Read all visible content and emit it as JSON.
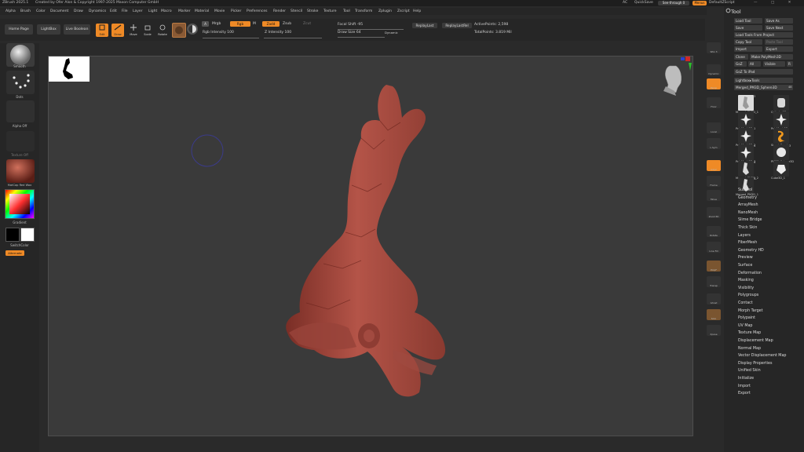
{
  "titlebar": {
    "app": "ZBrush 2025.1",
    "credits": "Created by Ofer Alon & Copyright 1997-2025 Maxon Computer GmbH",
    "ac_label": "AC",
    "quicksave": "QuickSave",
    "seethrough": "See-through 0",
    "menus": "Menus",
    "script": "DefaultZScript"
  },
  "menu": [
    "Alpha",
    "Brush",
    "Color",
    "Document",
    "Draw",
    "Dynamics",
    "Edit",
    "File",
    "Layer",
    "Light",
    "Macro",
    "Marker",
    "Material",
    "Movie",
    "Picker",
    "Preferences",
    "Render",
    "Stencil",
    "Stroke",
    "Texture",
    "Tool",
    "Transform",
    "Zplugin",
    "Zscript",
    "Help"
  ],
  "topshelf": {
    "home": "Home Page",
    "lightbox": "LightBox",
    "live_boolean": "Live Boolean",
    "edit": "Edit",
    "draw": "Draw",
    "move": "Move",
    "scale": "Scale",
    "rotate": "Rotate",
    "a": "A",
    "mrgb": "Mrgb",
    "rgb": "Rgb",
    "m": "M",
    "rgb_intensity": "Rgb Intensity 100",
    "zadd": "Zadd",
    "zsub": "Zsub",
    "zcut": "Zcut",
    "z_intensity": "Z Intensity 100",
    "focal_shift": "Focal Shift -95",
    "draw_size": "Draw Size 64",
    "dynamic": "Dynamic",
    "replay_last": "ReplayLast",
    "replay_last_rel": "ReplayLastRel",
    "active_points": "ActivePoints: 2,598",
    "total_points": "TotalPoints: 3.819 Mil"
  },
  "left": {
    "smooth": "Smooth",
    "dots": "Dots",
    "alpha_off": "Alpha Off",
    "texture_off": "Texture Off",
    "matcap": "MatCap Red Wax",
    "gradient": "Gradient",
    "switch_color": "SwitchColor",
    "alternate": "Alternate"
  },
  "rightshelf": [
    "SPix 3",
    "Dynamic",
    "Persp",
    "Floor",
    "Local",
    "L.Sym",
    "Gxyz",
    "Frame",
    "Move",
    "Zoom3D",
    "Rotate",
    "Line Fill",
    "PolyF",
    "Transp",
    "Ghost",
    "Solo",
    "Xpose"
  ],
  "tool": {
    "title": "Tool",
    "load": "Load Tool",
    "save_as": "Save As",
    "save": "Save",
    "save_next": "Save Next",
    "load_from_project": "Load Tools From Project",
    "copy": "Copy Tool",
    "paste": "Paste Tool",
    "import": "Import",
    "export": "Export",
    "clone": "Clone",
    "make_polymesh": "Make PolyMesh3D",
    "goz": "GoZ",
    "all": "All",
    "visible": "Visible",
    "r": "R",
    "goz_to_ipad": "GoZ To iPad",
    "lightbox_tools": "Lightbox▸Tools",
    "current": "Merged_PM3D_Sphere3D",
    "current_count": "48",
    "thumbs": [
      {
        "label": "Merged_PM3D_1",
        "count": "3"
      },
      {
        "label": "Cylinder3D",
        "count": ""
      },
      {
        "label": "PolyMesh3D_1",
        "count": ""
      },
      {
        "label": "PolyMesh3D",
        "count": ""
      },
      {
        "label": "PolyMesh3D_2",
        "count": ""
      },
      {
        "label": "SimpleBrush",
        "count": ""
      },
      {
        "label": "PolyMesh3D_3",
        "count": "4"
      },
      {
        "label": "PM3D_Sphere3D",
        "count": "3"
      },
      {
        "label": "Merged_PM3D_2",
        "count": "4"
      },
      {
        "label": "Cube3D_1",
        "count": ""
      },
      {
        "label": "Merged_PM3D_1",
        "count": "3"
      }
    ],
    "subpalettes": [
      "Subtool",
      "Geometry",
      "ArrayMesh",
      "NanoMesh",
      "Slime Bridge",
      "Thick Skin",
      "Layers",
      "FiberMesh",
      "Geometry HD",
      "Preview",
      "Surface",
      "Deformation",
      "Masking",
      "Visibility",
      "Polygroups",
      "Contact",
      "Morph Target",
      "Polypaint",
      "UV Map",
      "Texture Map",
      "Displacement Map",
      "Normal Map",
      "Vector Displacement Map",
      "Display Properties",
      "Unified Skin",
      "Initialize",
      "Import",
      "Export"
    ]
  },
  "colors": {
    "accent": "#ef8a26",
    "panel": "#262626",
    "viewport": "#3a3a3a",
    "model": "#a84a40"
  }
}
